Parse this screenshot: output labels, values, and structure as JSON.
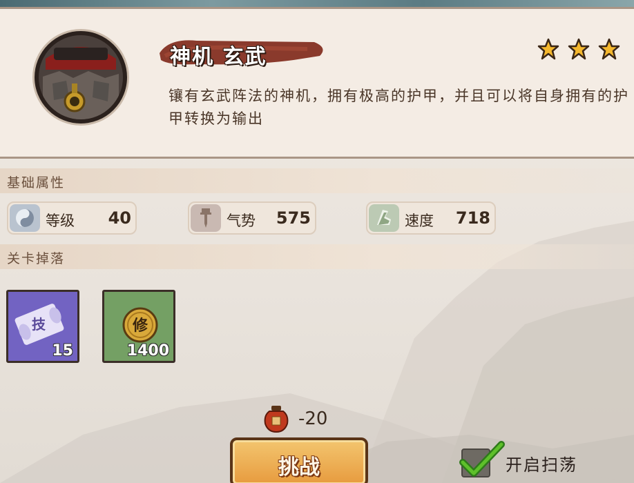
{
  "hero": {
    "name": "神机 玄武",
    "stars": 3,
    "description": "镶有玄武阵法的神机，拥有极高的护甲，并且可以将自身拥有的护甲转换为输出"
  },
  "sections": {
    "basic_attributes": "基础属性",
    "stage_drops": "关卡掉落"
  },
  "stats": [
    {
      "label": "等级",
      "value": "40",
      "icon": "level-icon"
    },
    {
      "label": "气势",
      "value": "575",
      "icon": "momentum-icon"
    },
    {
      "label": "速度",
      "value": "718",
      "icon": "speed-icon"
    }
  ],
  "drops": [
    {
      "icon": "scroll-icon",
      "glyph": "技",
      "count": "15",
      "color": "#6a5bb8"
    },
    {
      "icon": "coin-icon",
      "glyph": "修",
      "count": "1400",
      "color": "#6f9a5f"
    }
  ],
  "cost": {
    "icon": "wine-jar-icon",
    "value": "-20"
  },
  "challenge_button": "挑战",
  "sweep": {
    "label": "开启扫荡",
    "checked": true
  }
}
